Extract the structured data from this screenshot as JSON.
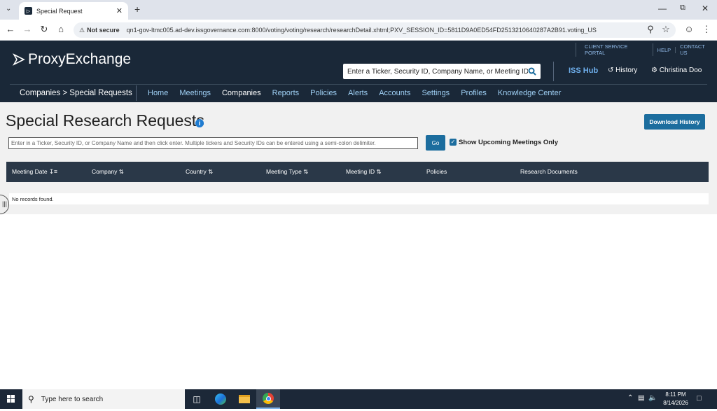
{
  "browser": {
    "tab_title": "Special Request",
    "security_label": "Not secure",
    "url": "qn1-gov-ltmc005.ad-dev.issgovernance.com:8000/voting/voting/research/researchDetail.xhtml;PXV_SESSION_ID=5811D9A0ED54FD2513210640287A2B91.voting_US"
  },
  "header": {
    "logo_text": "ProxyExchange",
    "top_links": [
      "CLIENT SERVICE PORTAL",
      "HELP",
      "CONTACT US"
    ],
    "search_placeholder": "Enter a Ticker, Security ID, Company Name, or Meeting ID",
    "iss_hub": "ISS Hub",
    "history": "History",
    "user_name": "Christina Doo",
    "breadcrumb": "Companies > Special Requests",
    "nav_items": [
      "Home",
      "Meetings",
      "Companies",
      "Reports",
      "Policies",
      "Alerts",
      "Accounts",
      "Settings",
      "Profiles",
      "Knowledge Center"
    ],
    "active_nav": "Companies"
  },
  "main": {
    "title": "Special Research Requests",
    "download_label": "Download History",
    "search_placeholder": "Enter in a Ticker, Security ID, or Company Name and then click enter.  Multiple tickers and Security IDs can be entered using a semi-colon delimiter.",
    "go_label": "Go",
    "checkbox_label": "Show Upcoming Meetings Only",
    "checkbox_checked": true,
    "columns": [
      "Meeting Date",
      "Company",
      "Country",
      "Meeting Type",
      "Meeting ID",
      "Policies",
      "Research Documents"
    ],
    "empty_message": "No records found."
  },
  "taskbar": {
    "search_placeholder": "Type here to search",
    "time": "8:11 PM",
    "date": "8/14/2026"
  }
}
